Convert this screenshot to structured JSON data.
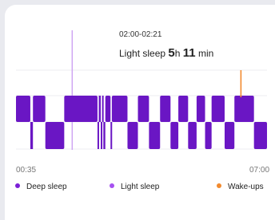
{
  "tooltip": {
    "time_range": "02:00-02:21",
    "stage_label": "Light sleep",
    "hours_value": "5",
    "hours_unit": "h",
    "minutes_value": "11",
    "minutes_unit": " min"
  },
  "axis": {
    "start_label": "00:35",
    "end_label": "07:00"
  },
  "legend": [
    {
      "label": "Deep sleep",
      "color": "#7b1fd6"
    },
    {
      "label": "Light sleep",
      "color": "#a651f0"
    },
    {
      "label": "Wake-ups",
      "color": "#f28a2e"
    }
  ],
  "colors": {
    "deep": "#6a16c4",
    "light": "#a651f0",
    "wake": "#f28a2e",
    "cursor": "#cfa6f2"
  },
  "chart_data": {
    "type": "timeline",
    "x_start": "00:35",
    "x_end": "07:00",
    "selected_segment": {
      "stage": "Light sleep",
      "start": "02:00",
      "end": "02:21"
    },
    "segments": [
      {
        "stage": "Light sleep",
        "start": "00:35",
        "end": "00:57"
      },
      {
        "stage": "Deep sleep",
        "start": "00:57",
        "end": "01:01"
      },
      {
        "stage": "Light sleep",
        "start": "01:01",
        "end": "01:20"
      },
      {
        "stage": "Deep sleep",
        "start": "01:20",
        "end": "01:49"
      },
      {
        "stage": "Light sleep",
        "start": "01:49",
        "end": "02:40"
      },
      {
        "stage": "Deep sleep",
        "start": "02:40",
        "end": "02:42"
      },
      {
        "stage": "Light sleep",
        "start": "02:42",
        "end": "02:45"
      },
      {
        "stage": "Deep sleep",
        "start": "02:45",
        "end": "02:47"
      },
      {
        "stage": "Light sleep",
        "start": "02:47",
        "end": "02:49"
      },
      {
        "stage": "Deep sleep",
        "start": "02:49",
        "end": "02:52"
      },
      {
        "stage": "Light sleep",
        "start": "02:52",
        "end": "03:00"
      },
      {
        "stage": "Deep sleep",
        "start": "03:00",
        "end": "03:02"
      },
      {
        "stage": "Light sleep",
        "start": "03:02",
        "end": "03:26"
      },
      {
        "stage": "Deep sleep",
        "start": "03:26",
        "end": "03:42"
      },
      {
        "stage": "Light sleep",
        "start": "03:42",
        "end": "03:59"
      },
      {
        "stage": "Deep sleep",
        "start": "03:59",
        "end": "04:16"
      },
      {
        "stage": "Light sleep",
        "start": "04:16",
        "end": "04:32"
      },
      {
        "stage": "Deep sleep",
        "start": "04:32",
        "end": "04:44"
      },
      {
        "stage": "Light sleep",
        "start": "04:44",
        "end": "04:59"
      },
      {
        "stage": "Deep sleep",
        "start": "04:59",
        "end": "05:12"
      },
      {
        "stage": "Light sleep",
        "start": "05:12",
        "end": "05:25"
      },
      {
        "stage": "Deep sleep",
        "start": "05:25",
        "end": "05:35"
      },
      {
        "stage": "Light sleep",
        "start": "05:35",
        "end": "05:55"
      },
      {
        "stage": "Deep sleep",
        "start": "05:55",
        "end": "06:10"
      },
      {
        "stage": "Light sleep",
        "start": "06:10",
        "end": "06:40"
      },
      {
        "stage": "Deep sleep",
        "start": "06:40",
        "end": "07:00"
      }
    ],
    "wake_ups": [
      "06:20"
    ]
  }
}
